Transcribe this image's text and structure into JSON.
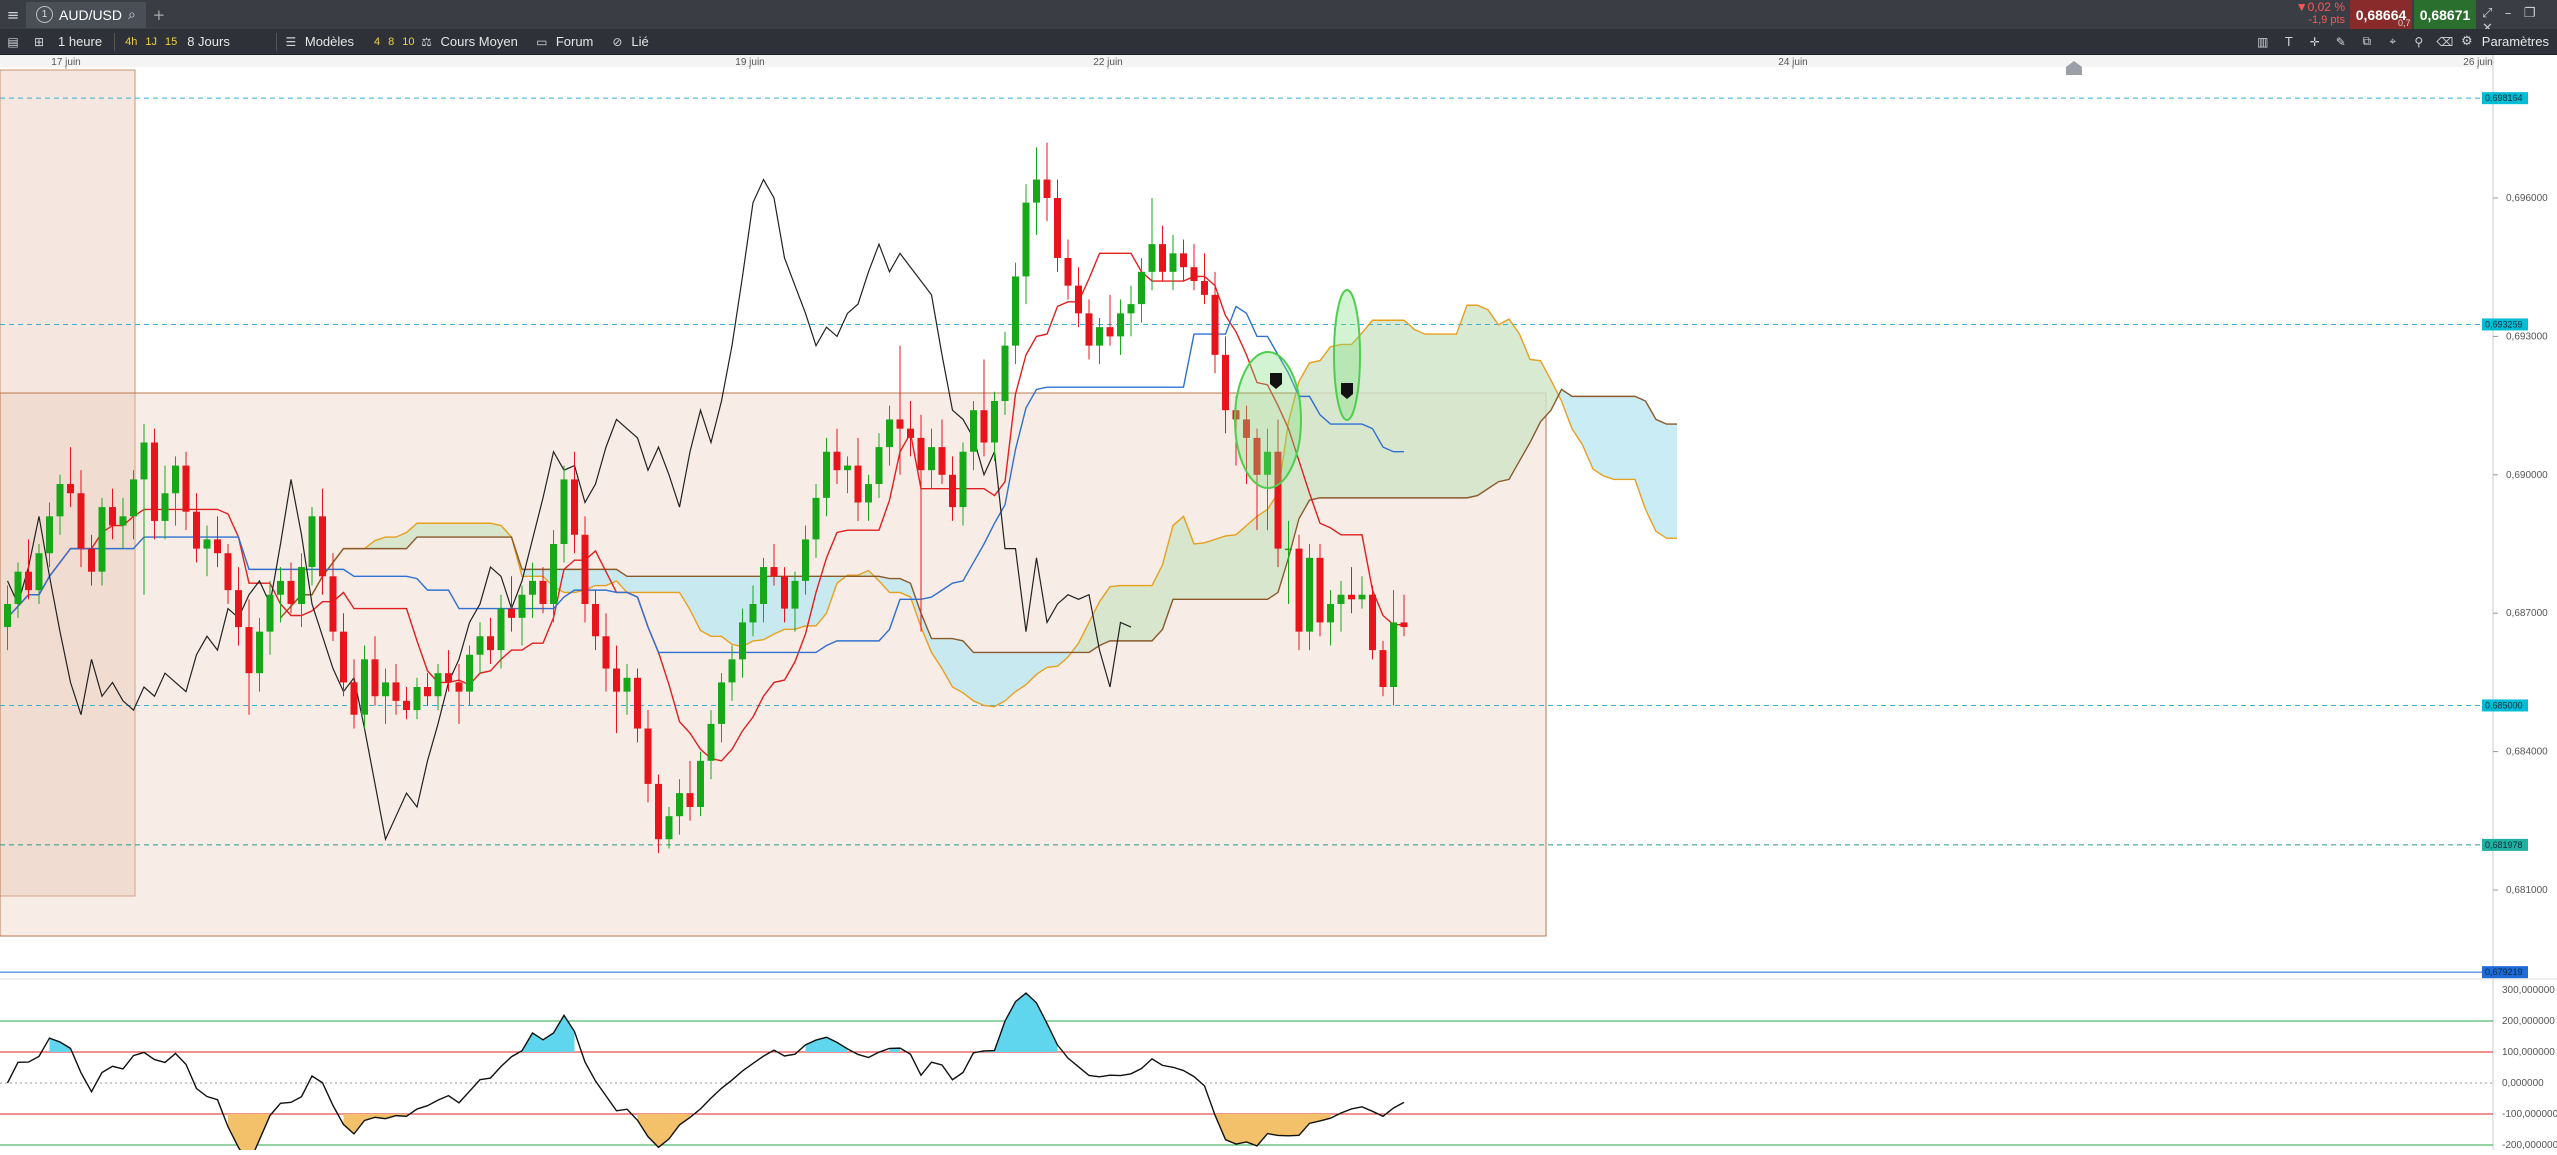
{
  "topbar": {
    "symbol": "AUD/USD",
    "symbol_number": "1",
    "add_tab": "+",
    "change_pct": "▼0,02 %",
    "change_pts": "-1,9 pts",
    "bid": "0,68664",
    "ask": "0,68671",
    "spread": "0,7"
  },
  "toolbar": {
    "interval": "1 heure",
    "quick_4h": "4h",
    "quick_1j": "1J",
    "quick_15": "15",
    "range": "8 Jours",
    "models": "Modèles",
    "q4": "4",
    "q8": "8",
    "q10": "10",
    "cours_moyen": "Cours Moyen",
    "forum": "Forum",
    "lie": "Lié",
    "params": "Paramètres"
  },
  "chart_data": [
    {
      "type": "line",
      "symbol": "AUD/USD",
      "x_ticks": [
        "17 juin",
        "19 juin",
        "22 juin",
        "24 juin",
        "26 juin"
      ],
      "y_ticks": [
        "0,696000",
        "0,693000",
        "0,690000",
        "0,687000",
        "0,684000",
        "0,681000"
      ],
      "price_tags": [
        {
          "value": "0,698164",
          "color": "#00bcd4"
        },
        {
          "value": "0,693259",
          "color": "#00bcd4"
        },
        {
          "value": "0,685000",
          "color": "#00bcd4"
        },
        {
          "value": "0,681978",
          "color": "#1fb0a0"
        },
        {
          "value": "0,679219",
          "color": "#1e6ad8"
        }
      ],
      "candles": [
        [
          0.6867,
          0.6876,
          0.6862,
          0.6872
        ],
        [
          0.6872,
          0.6881,
          0.6869,
          0.6879
        ],
        [
          0.6879,
          0.6886,
          0.6873,
          0.6875
        ],
        [
          0.6875,
          0.6885,
          0.6872,
          0.6883
        ],
        [
          0.6883,
          0.6894,
          0.688,
          0.6891
        ],
        [
          0.6891,
          0.69,
          0.6887,
          0.6898
        ],
        [
          0.6898,
          0.6906,
          0.6893,
          0.6896
        ],
        [
          0.6896,
          0.6901,
          0.688,
          0.6884
        ],
        [
          0.6884,
          0.6887,
          0.6876,
          0.6879
        ],
        [
          0.6879,
          0.6895,
          0.6876,
          0.6893
        ],
        [
          0.6893,
          0.6897,
          0.6886,
          0.6889
        ],
        [
          0.6889,
          0.6895,
          0.6884,
          0.6891
        ],
        [
          0.6891,
          0.6901,
          0.6886,
          0.6899
        ],
        [
          0.6899,
          0.6911,
          0.6874,
          0.6907
        ],
        [
          0.6907,
          0.691,
          0.6886,
          0.689
        ],
        [
          0.689,
          0.6902,
          0.6886,
          0.6896
        ],
        [
          0.6896,
          0.6904,
          0.6889,
          0.6902
        ],
        [
          0.6902,
          0.6905,
          0.6888,
          0.6892
        ],
        [
          0.6892,
          0.6896,
          0.6881,
          0.6884
        ],
        [
          0.6884,
          0.6889,
          0.6878,
          0.6886
        ],
        [
          0.6886,
          0.6891,
          0.688,
          0.6883
        ],
        [
          0.6883,
          0.6885,
          0.6872,
          0.6875
        ],
        [
          0.6875,
          0.688,
          0.6863,
          0.6867
        ],
        [
          0.6867,
          0.6873,
          0.6848,
          0.6857
        ],
        [
          0.6857,
          0.6869,
          0.6853,
          0.6866
        ],
        [
          0.6866,
          0.6877,
          0.6861,
          0.6874
        ],
        [
          0.6874,
          0.688,
          0.6868,
          0.6877
        ],
        [
          0.6877,
          0.6881,
          0.687,
          0.6872
        ],
        [
          0.6872,
          0.6883,
          0.6867,
          0.688
        ],
        [
          0.688,
          0.6893,
          0.6876,
          0.6891
        ],
        [
          0.6891,
          0.6897,
          0.6874,
          0.6878
        ],
        [
          0.6878,
          0.6883,
          0.6864,
          0.6866
        ],
        [
          0.6866,
          0.687,
          0.6852,
          0.6855
        ],
        [
          0.6855,
          0.686,
          0.6845,
          0.6848
        ],
        [
          0.6848,
          0.6863,
          0.6845,
          0.686
        ],
        [
          0.686,
          0.6865,
          0.685,
          0.6852
        ],
        [
          0.6852,
          0.6858,
          0.6846,
          0.6855
        ],
        [
          0.6855,
          0.6859,
          0.6848,
          0.6851
        ],
        [
          0.6851,
          0.6854,
          0.6847,
          0.6849
        ],
        [
          0.6849,
          0.6856,
          0.6847,
          0.6854
        ],
        [
          0.6854,
          0.6857,
          0.685,
          0.6852
        ],
        [
          0.6852,
          0.6859,
          0.6849,
          0.6857
        ],
        [
          0.6857,
          0.6862,
          0.6853,
          0.6855
        ],
        [
          0.6855,
          0.6859,
          0.6846,
          0.6853
        ],
        [
          0.6853,
          0.6863,
          0.685,
          0.6861
        ],
        [
          0.6861,
          0.6868,
          0.6857,
          0.6865
        ],
        [
          0.6865,
          0.6869,
          0.6859,
          0.6862
        ],
        [
          0.6862,
          0.6874,
          0.6858,
          0.6871
        ],
        [
          0.6871,
          0.6878,
          0.6866,
          0.6869
        ],
        [
          0.6869,
          0.6876,
          0.6863,
          0.6874
        ],
        [
          0.6874,
          0.6881,
          0.6869,
          0.6877
        ],
        [
          0.6877,
          0.688,
          0.687,
          0.6872
        ],
        [
          0.6872,
          0.6888,
          0.6868,
          0.6885
        ],
        [
          0.6885,
          0.6902,
          0.6881,
          0.6899
        ],
        [
          0.6899,
          0.6905,
          0.6883,
          0.6887
        ],
        [
          0.6887,
          0.6891,
          0.6868,
          0.6872
        ],
        [
          0.6872,
          0.6875,
          0.6862,
          0.6865
        ],
        [
          0.6865,
          0.687,
          0.6853,
          0.6858
        ],
        [
          0.6858,
          0.6863,
          0.6844,
          0.6853
        ],
        [
          0.6853,
          0.6859,
          0.6848,
          0.6856
        ],
        [
          0.6856,
          0.6858,
          0.6842,
          0.6845
        ],
        [
          0.6845,
          0.6849,
          0.6829,
          0.6833
        ],
        [
          0.6833,
          0.6835,
          0.6818,
          0.6821
        ],
        [
          0.6821,
          0.6828,
          0.6819,
          0.6826
        ],
        [
          0.6826,
          0.6834,
          0.6822,
          0.6831
        ],
        [
          0.6831,
          0.6838,
          0.6825,
          0.6828
        ],
        [
          0.6828,
          0.684,
          0.6826,
          0.6838
        ],
        [
          0.6838,
          0.6849,
          0.6834,
          0.6846
        ],
        [
          0.6846,
          0.6857,
          0.6842,
          0.6855
        ],
        [
          0.6855,
          0.6863,
          0.6851,
          0.686
        ],
        [
          0.686,
          0.6871,
          0.6856,
          0.6868
        ],
        [
          0.6868,
          0.6876,
          0.6865,
          0.6872
        ],
        [
          0.6872,
          0.6882,
          0.6868,
          0.688
        ],
        [
          0.688,
          0.6885,
          0.6876,
          0.6878
        ],
        [
          0.6878,
          0.688,
          0.6868,
          0.6871
        ],
        [
          0.6871,
          0.6879,
          0.6866,
          0.6877
        ],
        [
          0.6877,
          0.6889,
          0.6874,
          0.6886
        ],
        [
          0.6886,
          0.6898,
          0.6882,
          0.6895
        ],
        [
          0.6895,
          0.6908,
          0.6891,
          0.6905
        ],
        [
          0.6905,
          0.691,
          0.6898,
          0.6901
        ],
        [
          0.6901,
          0.6904,
          0.6896,
          0.6902
        ],
        [
          0.6902,
          0.6908,
          0.689,
          0.6894
        ],
        [
          0.6894,
          0.69,
          0.689,
          0.6898
        ],
        [
          0.6898,
          0.6909,
          0.6895,
          0.6906
        ],
        [
          0.6906,
          0.6915,
          0.6902,
          0.6912
        ],
        [
          0.6912,
          0.6928,
          0.69,
          0.691
        ],
        [
          0.691,
          0.6916,
          0.6904,
          0.6908
        ],
        [
          0.6908,
          0.6913,
          0.6866,
          0.6901
        ],
        [
          0.6901,
          0.691,
          0.6897,
          0.6906
        ],
        [
          0.6906,
          0.6912,
          0.6898,
          0.69
        ],
        [
          0.69,
          0.6904,
          0.689,
          0.6893
        ],
        [
          0.6893,
          0.6907,
          0.6889,
          0.6905
        ],
        [
          0.6905,
          0.6916,
          0.6901,
          0.6914
        ],
        [
          0.6914,
          0.6925,
          0.6904,
          0.6907
        ],
        [
          0.6907,
          0.6918,
          0.6903,
          0.6916
        ],
        [
          0.6916,
          0.6931,
          0.6913,
          0.6928
        ],
        [
          0.6928,
          0.6946,
          0.6924,
          0.6943
        ],
        [
          0.6943,
          0.6963,
          0.6937,
          0.6959
        ],
        [
          0.6959,
          0.6971,
          0.6952,
          0.6964
        ],
        [
          0.6964,
          0.6972,
          0.6955,
          0.696
        ],
        [
          0.696,
          0.6964,
          0.6944,
          0.6947
        ],
        [
          0.6947,
          0.6951,
          0.6938,
          0.6941
        ],
        [
          0.6941,
          0.6945,
          0.6932,
          0.6935
        ],
        [
          0.6935,
          0.6938,
          0.6925,
          0.6928
        ],
        [
          0.6928,
          0.6934,
          0.6924,
          0.6932
        ],
        [
          0.6932,
          0.6939,
          0.6928,
          0.693
        ],
        [
          0.693,
          0.6938,
          0.6926,
          0.6935
        ],
        [
          0.6935,
          0.6941,
          0.693,
          0.6937
        ],
        [
          0.6937,
          0.6947,
          0.6933,
          0.6944
        ],
        [
          0.6944,
          0.696,
          0.694,
          0.695
        ],
        [
          0.695,
          0.6954,
          0.6942,
          0.6944
        ],
        [
          0.6944,
          0.6952,
          0.694,
          0.6948
        ],
        [
          0.6948,
          0.6951,
          0.6942,
          0.6945
        ],
        [
          0.6945,
          0.695,
          0.694,
          0.6942
        ],
        [
          0.6942,
          0.6948,
          0.6937,
          0.6939
        ],
        [
          0.6939,
          0.6944,
          0.6922,
          0.6926
        ],
        [
          0.6926,
          0.693,
          0.6909,
          0.6914
        ],
        [
          0.6914,
          0.6917,
          0.6902,
          0.6912
        ],
        [
          0.6912,
          0.6915,
          0.6898,
          0.6908
        ],
        [
          0.6908,
          0.691,
          0.6888,
          0.69
        ],
        [
          0.69,
          0.691,
          0.6888,
          0.6905
        ],
        [
          0.6905,
          0.6912,
          0.688,
          0.6884
        ],
        [
          0.6884,
          0.689,
          0.6872,
          0.6884
        ],
        [
          0.6884,
          0.6887,
          0.6862,
          0.6866
        ],
        [
          0.6866,
          0.6885,
          0.6862,
          0.6882
        ],
        [
          0.6882,
          0.6885,
          0.6865,
          0.6868
        ],
        [
          0.6868,
          0.6875,
          0.6863,
          0.6872
        ],
        [
          0.6872,
          0.6877,
          0.6866,
          0.6874
        ],
        [
          0.6874,
          0.688,
          0.687,
          0.6873
        ],
        [
          0.6873,
          0.6878,
          0.6871,
          0.6874
        ],
        [
          0.6874,
          0.6876,
          0.686,
          0.6862
        ],
        [
          0.6862,
          0.6864,
          0.6852,
          0.6854
        ],
        [
          0.6854,
          0.6875,
          0.685,
          0.6868
        ],
        [
          0.6868,
          0.6874,
          0.6865,
          0.6867
        ]
      ],
      "lines": {
        "tenkan_color": "#e02020",
        "kijun_color": "#3070d0",
        "senkou_a_color": "#e6a020",
        "senkou_b_color": "#8a5a2a",
        "chikou_color": "#222222"
      },
      "cci": {
        "y_ticks": [
          "300,000000",
          "200,000000",
          "100,000000",
          "0,000000",
          "-100,000000",
          "-200,000000"
        ],
        "levels": [
          200,
          100,
          0,
          -100,
          -200
        ]
      }
    }
  ]
}
